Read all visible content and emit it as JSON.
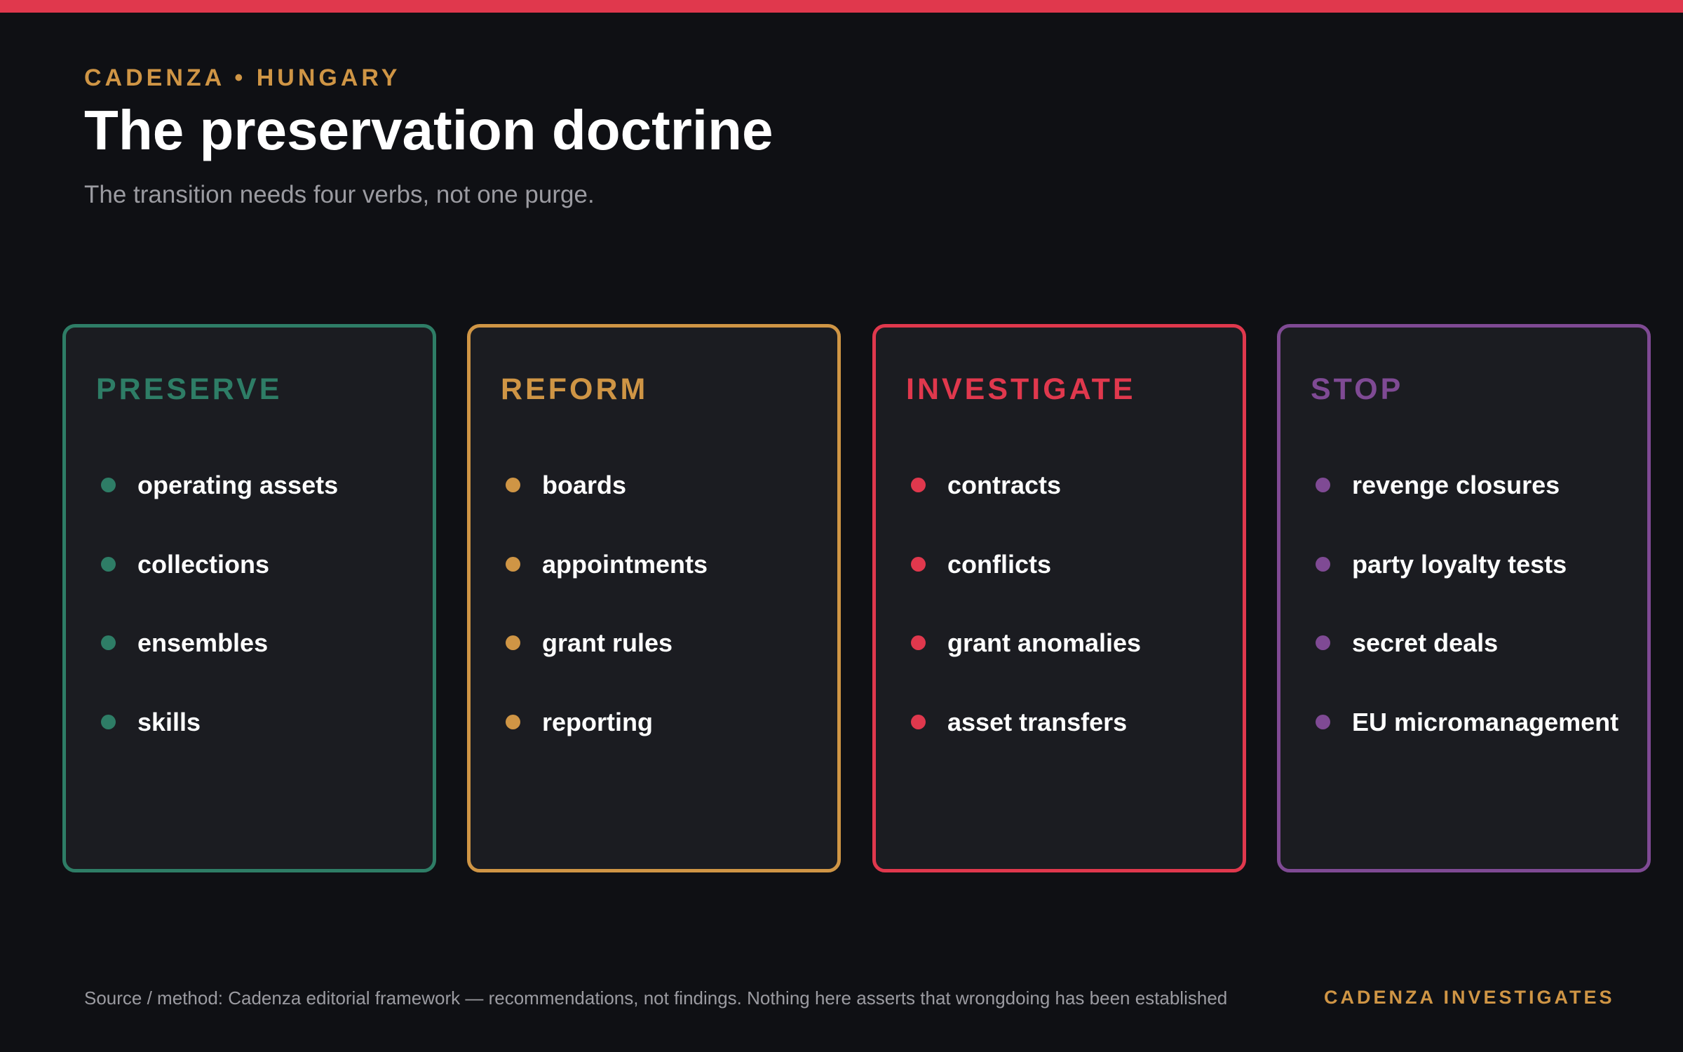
{
  "header": {
    "kicker": "CADENZA • HUNGARY",
    "title": "The preservation doctrine",
    "subtitle": "The transition needs four verbs, not one purge."
  },
  "colors": {
    "top_bar": "#e0384d",
    "background": "#0f1014",
    "card_background": "#1b1c21",
    "accent_gold": "#cf9545"
  },
  "cards": [
    {
      "title": "PRESERVE",
      "color": "#2e7d66",
      "items": [
        "operating assets",
        "collections",
        "ensembles",
        "skills"
      ]
    },
    {
      "title": "REFORM",
      "color": "#cf9545",
      "items": [
        "boards",
        "appointments",
        "grant rules",
        "reporting"
      ]
    },
    {
      "title": "INVESTIGATE",
      "color": "#e0384d",
      "items": [
        "contracts",
        "conflicts",
        "grant anomalies",
        "asset transfers"
      ]
    },
    {
      "title": "STOP",
      "color": "#7f4a94",
      "items": [
        "revenge closures",
        "party loyalty tests",
        "secret deals",
        "EU micromanagement"
      ]
    }
  ],
  "footer": {
    "source": "Source / method: Cadenza editorial framework — recommendations, not findings. Nothing here asserts that wrongdoing has been established",
    "brand": "CADENZA INVESTIGATES"
  }
}
